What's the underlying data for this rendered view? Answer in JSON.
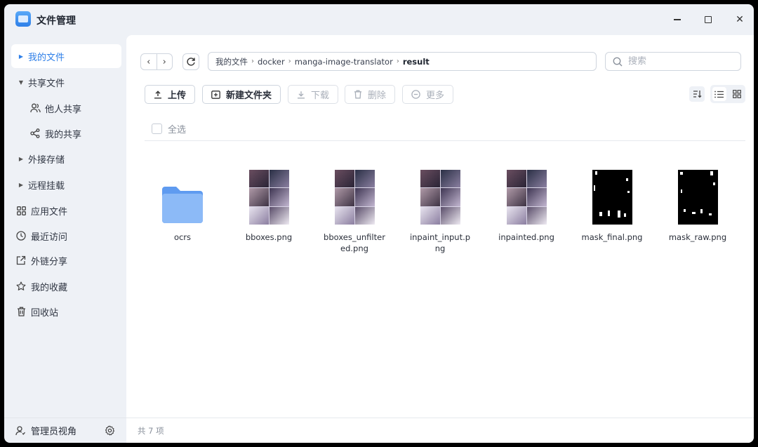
{
  "app": {
    "title": "文件管理"
  },
  "sidebar": {
    "items": [
      {
        "label": "我的文件"
      },
      {
        "label": "共享文件"
      },
      {
        "label": "他人共享"
      },
      {
        "label": "我的共享"
      },
      {
        "label": "外接存储"
      },
      {
        "label": "远程挂载"
      },
      {
        "label": "应用文件"
      },
      {
        "label": "最近访问"
      },
      {
        "label": "外链分享"
      },
      {
        "label": "我的收藏"
      },
      {
        "label": "回收站"
      }
    ],
    "footer": {
      "label": "管理员视角"
    }
  },
  "breadcrumb": [
    "我的文件",
    "docker",
    "manga-image-translator",
    "result"
  ],
  "search": {
    "placeholder": "搜索"
  },
  "toolbar": {
    "upload": "上传",
    "new_folder": "新建文件夹",
    "download": "下载",
    "delete": "删除",
    "more": "更多"
  },
  "select_all": "全选",
  "files": [
    {
      "name": "ocrs",
      "type": "folder"
    },
    {
      "name": "bboxes.png",
      "type": "image"
    },
    {
      "name": "bboxes_unfiltered.png",
      "type": "image"
    },
    {
      "name": "inpaint_input.png",
      "type": "image"
    },
    {
      "name": "inpainted.png",
      "type": "image"
    },
    {
      "name": "mask_final.png",
      "type": "mask"
    },
    {
      "name": "mask_raw.png",
      "type": "mask"
    }
  ],
  "status": {
    "count_text": "共 7 项"
  },
  "colors": {
    "accent": "#2e7fe8",
    "folder": "#7fb0f5"
  }
}
